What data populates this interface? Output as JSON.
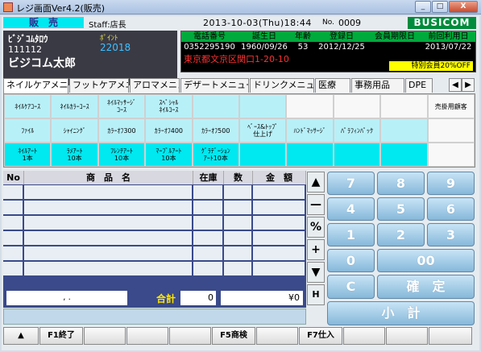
{
  "window": {
    "title": "レジ画面Ver4.2(販売)",
    "btn_min": "_",
    "btn_max": "□",
    "btn_close": "X"
  },
  "header": {
    "mode": "販　売",
    "staff": "Staff:店長",
    "datetime": "2013-10-03(Thu)18:44",
    "no_label": "No.",
    "no_value": "0009",
    "brand": "BUSICOM"
  },
  "customer": {
    "kana": "ﾋﾞｼﾞｺﾑﾀﾛｳ",
    "id": "111112",
    "point_label": "ﾎﾟｲﾝﾄ",
    "point_value": "22018",
    "name": "ビジコム太郎"
  },
  "info": {
    "headers": [
      "電話番号",
      "誕生日",
      "年齢",
      "登録日",
      "会員期限日",
      "前回利用日"
    ],
    "values": [
      "0352295190",
      "1960/09/26",
      "53",
      "2012/12/25",
      "",
      "2013/07/22"
    ],
    "address": "東京都文京区関口1-20-10",
    "badge": "特別会員20%OFF"
  },
  "tabs": [
    "ネイルケアメニュー",
    "フットケアメニュー",
    "アロマメニュー",
    "デザートメニュー",
    "ドリンクメニュー",
    "医療",
    "事務用品",
    "DPE"
  ],
  "tab_arrows": {
    "left": "◀",
    "right": "▶"
  },
  "grid": {
    "row1": [
      "ﾈｲﾙｹｱｺｰｽ",
      "ﾈｲﾙｶﾗｰｺｰｽ",
      "ﾈｲﾙﾏｯｻｰｼﾞ\nｺｰｽ",
      "ｽﾍﾟｼｬﾙ\nﾈｲﾙｺｰｽ",
      "",
      "",
      "",
      "",
      "",
      "売掛用顧客"
    ],
    "row2": [
      "ﾌｧｲﾙ",
      "ｼｬｲﾆﾝｸﾞ",
      "ｶﾗｰｵﾌ300",
      "ｶﾗｰｵﾌ400",
      "ｶﾗｰｵﾌ500",
      "ﾍﾞｰｽ&ﾄｯﾌﾟ\n仕上げ",
      "ﾊﾝﾄﾞﾏｯｻｰｼﾞ",
      "ﾊﾟﾗﾌｨﾝﾊﾟｯｸ",
      "",
      ""
    ],
    "row3": [
      "ﾈｲﾙｱｰﾄ\n1本",
      "ﾗﾒｱｰﾄ\n10本",
      "ﾌﾚﾝﾁｱｰﾄ\n10本",
      "ﾏｰﾌﾞﾙｱｰﾄ\n10本",
      "ｸﾞﾗﾃﾞｰｼｮﾝ\nｱｰﾄ10本",
      "",
      "",
      "",
      "",
      ""
    ]
  },
  "items": {
    "headers": [
      "No",
      "商　品　名",
      "在庫",
      "数",
      "金　額"
    ]
  },
  "totals": {
    "box_text": ",        .",
    "label": "合計",
    "qty": "0",
    "amount": "¥0"
  },
  "side": [
    "▲",
    "—",
    "%",
    "+",
    "▼",
    "H"
  ],
  "keypad": [
    "7",
    "8",
    "9",
    "4",
    "5",
    "6",
    "1",
    "2",
    "3",
    "0",
    "00",
    "C",
    "確　定",
    "小　計"
  ],
  "fbar": [
    "▲",
    "F1終了",
    "",
    "",
    "",
    "F5商検",
    "",
    "F7仕入",
    "",
    "",
    ""
  ]
}
